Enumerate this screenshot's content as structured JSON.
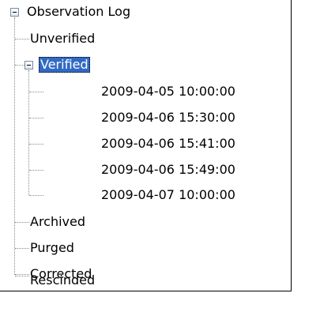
{
  "tree": {
    "root": {
      "label": "Observation Log",
      "expanded": true
    },
    "items": [
      {
        "label": "Unverified"
      },
      {
        "label": "Verified",
        "expanded": true,
        "selected": true,
        "children": [
          {
            "label": "2009-04-05 10:00:00"
          },
          {
            "label": "2009-04-06 15:30:00"
          },
          {
            "label": "2009-04-06 15:41:00"
          },
          {
            "label": "2009-04-06 15:49:00"
          },
          {
            "label": "2009-04-07 10:00:00"
          }
        ]
      },
      {
        "label": "Archived"
      },
      {
        "label": "Purged"
      },
      {
        "label": "Corrected"
      },
      {
        "label": "Rescinded"
      }
    ]
  },
  "colors": {
    "selection_background": "#316ac5",
    "selection_text": "#ffffff",
    "connector_line": "#8a8a8a"
  }
}
